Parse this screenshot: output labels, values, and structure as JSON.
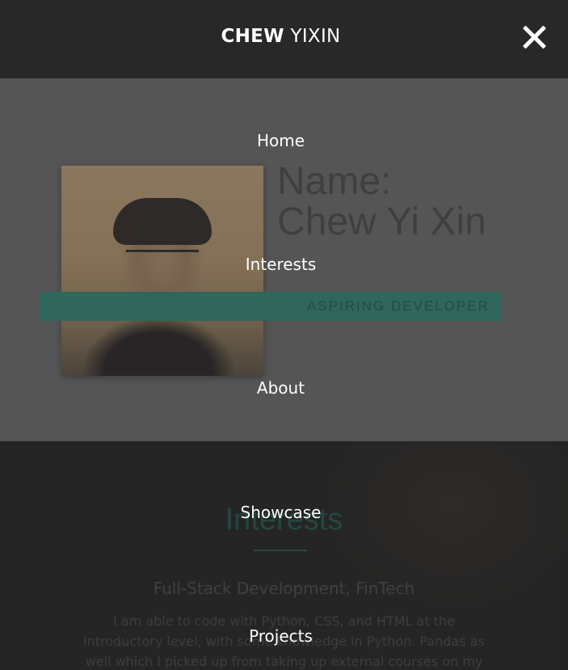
{
  "header": {
    "brand_strong": "CHEW",
    "brand_light": "YIXIN"
  },
  "menu": {
    "items": [
      {
        "label": "Home"
      },
      {
        "label": "Interests"
      },
      {
        "label": "About"
      },
      {
        "label": "Showcase"
      },
      {
        "label": "Projects"
      }
    ]
  },
  "hero": {
    "name_label": "Name:",
    "name_value": "Chew Yi Xin",
    "role": "ASPIRING DEVELOPER"
  },
  "interests": {
    "title": "Interests",
    "subtitle": "Full-Stack Development, FinTech",
    "body": "I am able to code with Python, CSS, and HTML at the introductory level, with some knowledge in Python. Pandas as well which I picked up from taking up external courses on my"
  },
  "icons": {
    "close": "close-icon"
  },
  "colors": {
    "topbar": "#282828",
    "accent": "#3e9b88",
    "menu_text": "#ffffff"
  }
}
